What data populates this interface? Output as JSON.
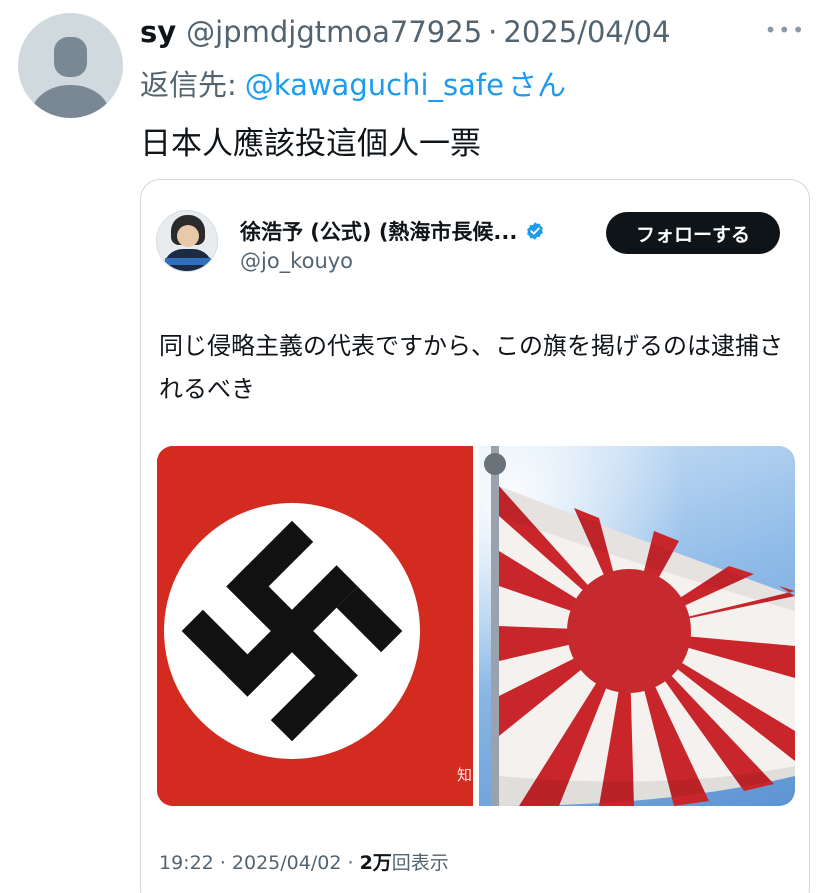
{
  "tweet": {
    "author_name": "sy",
    "author_handle": "@jpmdjgtmoa77925",
    "separator": "·",
    "date": "2025/04/04",
    "more_icon": "more-dots-icon",
    "reply_prefix": "返信先:",
    "reply_handle": "@kawaguchi_safe",
    "reply_suffix": "さん",
    "text": "日本人應該投這個人一票"
  },
  "quoted": {
    "author_name": "徐浩予 (公式) (熱海市長候...",
    "author_handle": "@jo_kouyo",
    "verified_icon": "verified-badge-icon",
    "follow_label": "フォローする",
    "text": "同じ侵略主義の代表ですから、この旗を掲げるのは逮捕されるべき",
    "images": [
      "nazi-flag-image",
      "rising-sun-flag-image"
    ],
    "watermark": "知",
    "time": "19:22",
    "separator": "·",
    "date": "2025/04/02",
    "views_count": "2万",
    "views_label": "回表示"
  },
  "colors": {
    "accent": "#1d9bf0",
    "text": "#0f1419",
    "muted": "#536471",
    "border": "#cfd9de",
    "button": "#0f1419",
    "flag_red": "#d32b1f"
  }
}
